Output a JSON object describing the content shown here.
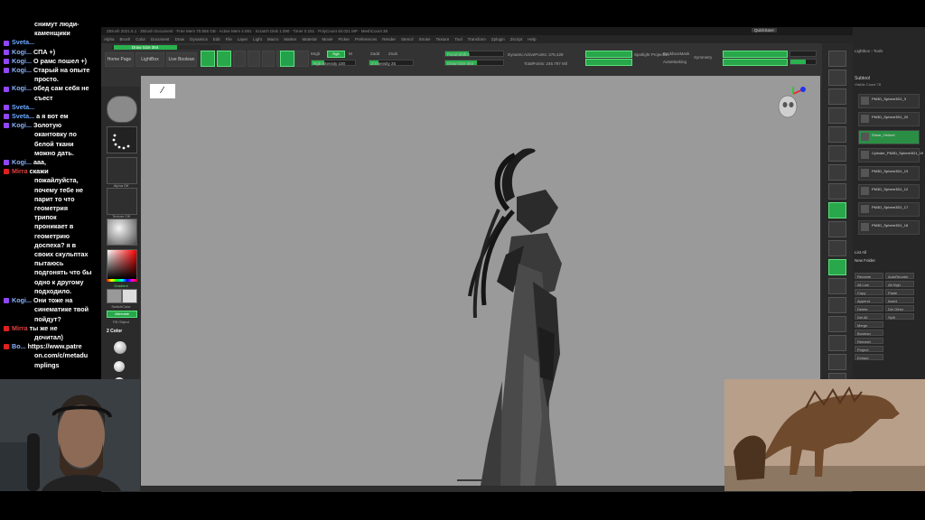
{
  "chat": {
    "messages": [
      {
        "user": "",
        "text": "снимут люди-"
      },
      {
        "user": "",
        "text": "каменщики"
      },
      {
        "user": "Sveta...",
        "text": ""
      },
      {
        "user": "Kogi...",
        "text": "СПА +)"
      },
      {
        "user": "Kogi...",
        "text": "О рамс пошел +)"
      },
      {
        "user": "Kogi...",
        "text": "Старый на опыте"
      },
      {
        "user": "",
        "text": "просто."
      },
      {
        "user": "Kogi...",
        "text": "обед сам себя не"
      },
      {
        "user": "",
        "text": "съест"
      },
      {
        "user": "Sveta...",
        "text": ""
      },
      {
        "user": "Sveta...",
        "text": "а я вот ем"
      },
      {
        "user": "Kogi...",
        "text": "Золотую"
      },
      {
        "user": "",
        "text": "окантовку по"
      },
      {
        "user": "",
        "text": "белой ткани"
      },
      {
        "user": "",
        "text": "можно дать."
      },
      {
        "user": "Kogi...",
        "text": "ааа,"
      },
      {
        "user": "Mirra",
        "text": "скажи"
      },
      {
        "user": "",
        "text": "пожайлуйста,"
      },
      {
        "user": "",
        "text": "почему тебе не"
      },
      {
        "user": "",
        "text": "парит то что"
      },
      {
        "user": "",
        "text": "геометрия"
      },
      {
        "user": "",
        "text": "трипок"
      },
      {
        "user": "",
        "text": "проникает в"
      },
      {
        "user": "",
        "text": "геометрию"
      },
      {
        "user": "",
        "text": "доспеха? я в"
      },
      {
        "user": "",
        "text": "своих скульптах"
      },
      {
        "user": "",
        "text": "пытаюсь"
      },
      {
        "user": "",
        "text": "подгонять что бы"
      },
      {
        "user": "",
        "text": "одно к другому"
      },
      {
        "user": "",
        "text": "подходило."
      },
      {
        "user": "Kogi...",
        "text": "Они тоже на"
      },
      {
        "user": "",
        "text": "синематике твой"
      },
      {
        "user": "",
        "text": "пойдут?"
      },
      {
        "user": "Mirra",
        "text": "ты же не"
      },
      {
        "user": "",
        "text": "дочитал)"
      },
      {
        "user": "Bo...",
        "text": "https://www.patre"
      },
      {
        "user": "",
        "text": "on.com/c/metadu"
      },
      {
        "user": "",
        "text": "mplings"
      }
    ]
  },
  "zbrush": {
    "title_bar": "ZBrush 2021.5.1 · ZBrush Document · Free Mem 70.655 GB · Active Mem 4.081 · Scratch Disk 1.090 · Timer 0.151 · PolyCount 45.021 MP · MeshCount 38",
    "quicksave": "QuickSave",
    "menus": [
      "Alpha",
      "Brush",
      "Color",
      "Document",
      "Draw",
      "Dynamics",
      "Edit",
      "File",
      "Layer",
      "Light",
      "Macro",
      "Marker",
      "Material",
      "Movie",
      "Picker",
      "Preferences",
      "Render",
      "Stencil",
      "Stroke",
      "Texture",
      "Tool",
      "Transform",
      "Zplugin",
      "Zscript",
      "Help"
    ],
    "draw_size_strip": "Draw Size 364",
    "toolbar": {
      "home_page": "Home Page",
      "lightbox": "LightBox",
      "live_boolean": "Live Boolean",
      "edit": "Edit",
      "draw": "Draw",
      "move": "Move",
      "scale": "Scale",
      "rotate": "Rotate",
      "mrgb": "Mrgb",
      "rgb": "Rgb",
      "m": "M",
      "zadd": "Zadd",
      "zsub": "Zsub",
      "rgb_intensity": "Rgb Intensity 100",
      "z_intensity": "Z Intensity 25",
      "focal_shift": "Focal Shift 0",
      "draw_size": "Draw Size 364",
      "dynamic": "Dynamic",
      "active_points": "ActivePoints: 476,428",
      "total_points": "TotalPoints: 245.797 Mil",
      "spotlight_projection": "Spotlight Projection",
      "backface_mask": "BackfaceMask",
      "auto_masking": "AutoMasking",
      "sym_label": "Symmetry"
    },
    "left_tray": {
      "texture_off": "Texture Off",
      "alpha_off": "Alpha Off",
      "gradient": "Gradient",
      "switch_color": "SwitchColor",
      "alternate": "Alternate",
      "fill_object": "Fill Object",
      "color_count": "2 Color"
    }
  },
  "right_panel": {
    "header": "Lightbox › Tools",
    "subtool": "Subtool",
    "visible_count": "Visible Count 78",
    "items": [
      "PM3D_Sphere3D1_3",
      "PM3D_Sphere3D1_20",
      "Shear_Helmet",
      "Cylinder_PM3D_Sphere3D1_19",
      "PM3D_Sphere3D1_19",
      "PM3D_Sphere3D1_12",
      "PM3D_Sphere3D1_17",
      "PM3D_Sphere3D1_18"
    ],
    "list_all": "List All",
    "new_folder": "New Folder",
    "buttons": [
      "Rename",
      "AutoReorder",
      "All Low",
      "All High",
      "Copy",
      "Paste",
      "Append",
      "Insert",
      "Delete",
      "Del Other",
      "Del All",
      "Split",
      "Merge",
      "Boolean",
      "Remesh",
      "Project",
      "Extract"
    ]
  }
}
